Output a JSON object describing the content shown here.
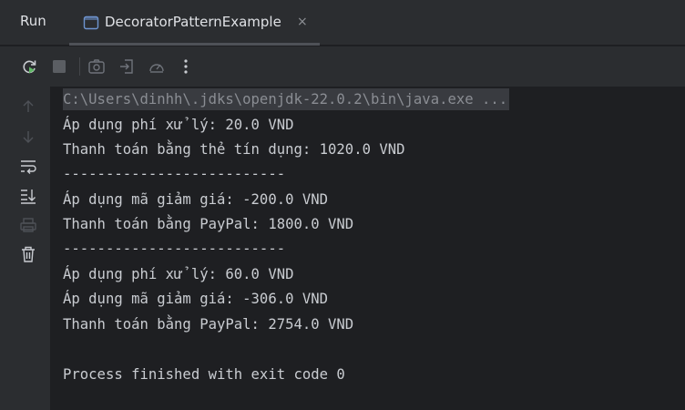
{
  "header": {
    "run_label": "Run",
    "tab": {
      "label": "DecoratorPatternExample",
      "icon": "run-config-icon",
      "close_glyph": "×"
    }
  },
  "toolbar": {
    "buttons": [
      "rerun-icon",
      "stop-icon",
      "screenshot-icon",
      "restore-layout-icon",
      "profiler-icon",
      "more-options-icon"
    ]
  },
  "gutter": {
    "buttons": [
      "arrow-up-icon",
      "arrow-down-icon",
      "soft-wrap-icon",
      "scroll-to-end-icon",
      "print-icon",
      "trash-icon"
    ]
  },
  "console": {
    "command": "C:\\Users\\dinhh\\.jdks\\openjdk-22.0.2\\bin\\java.exe ...",
    "lines": [
      "Áp dụng phí xử lý: 20.0 VND",
      "Thanh toán bằng thẻ tín dụng: 1020.0 VND",
      "--------------------------",
      "Áp dụng mã giảm giá: -200.0 VND",
      "Thanh toán bằng PayPal: 1800.0 VND",
      "--------------------------",
      "Áp dụng phí xử lý: 60.0 VND",
      "Áp dụng mã giảm giá: -306.0 VND",
      "Thanh toán bằng PayPal: 2754.0 VND",
      "",
      "Process finished with exit code 0"
    ]
  },
  "colors": {
    "background": "#1e1f22",
    "panel": "#2b2d30",
    "text": "#c9ccd1",
    "command_text": "#8a8d93",
    "rerun_green": "#5fb865"
  }
}
